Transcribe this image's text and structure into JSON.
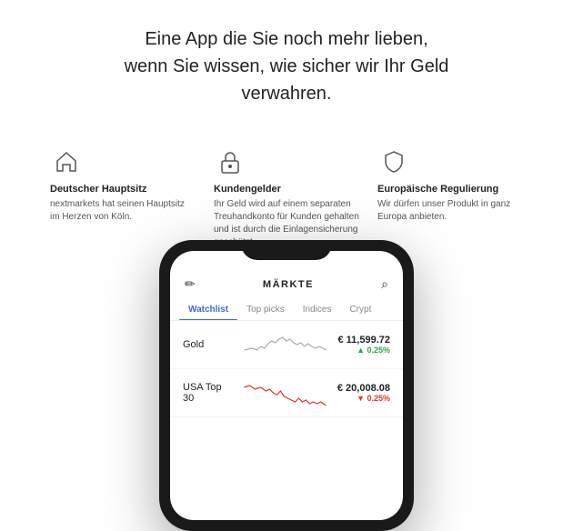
{
  "header": {
    "line1": "Eine App die Sie noch mehr lieben,",
    "line2": "wenn Sie wissen, wie sicher wir Ihr Geld",
    "line3": "verwahren."
  },
  "features": [
    {
      "id": "home",
      "title": "Deutscher Hauptsitz",
      "description": "nextmarkets hat seinen Hauptsitz im Herzen von Köln.",
      "icon": "home"
    },
    {
      "id": "lock",
      "title": "Kundengelder",
      "description": "Ihr Geld wird auf einem separaten Treuhandkonto für Kunden gehalten und ist durch die Einlagensicherung geschützt.",
      "icon": "lock"
    },
    {
      "id": "shield",
      "title": "Europäische Regulierung",
      "description": "Wir dürfen unser Produkt in ganz Europa anbieten.",
      "icon": "shield"
    }
  ],
  "app": {
    "header_title": "MÄRKTE",
    "tabs": [
      {
        "label": "Watchlist",
        "active": true
      },
      {
        "label": "Top picks",
        "active": false
      },
      {
        "label": "Indices",
        "active": false
      },
      {
        "label": "Crypt",
        "active": false
      }
    ],
    "stocks": [
      {
        "name": "Gold",
        "price": "€ 11,599.72",
        "change": "▲ 0.25%",
        "direction": "up"
      },
      {
        "name": "USA Top 30",
        "price": "€ 20,008.08",
        "change": "▼ 0.25%",
        "direction": "down"
      }
    ]
  },
  "colors": {
    "accent_blue": "#4169e1",
    "up_green": "#22aa44",
    "down_red": "#e63322",
    "feature_title": "#222222",
    "feature_desc": "#555555"
  }
}
